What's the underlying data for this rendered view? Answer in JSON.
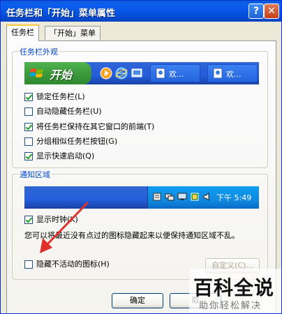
{
  "window": {
    "title": "任务栏和「开始」菜单属性",
    "help_glyph": "?",
    "close_glyph": "✕"
  },
  "tabs": [
    {
      "label": "任务栏",
      "active": true
    },
    {
      "label": "「开始」菜单",
      "active": false
    }
  ],
  "taskbar_appearance": {
    "group_title": "任务栏外观",
    "start_label": "开始",
    "task_buttons": [
      {
        "label": "欢..."
      },
      {
        "label": "欢..."
      }
    ],
    "options": [
      {
        "label": "锁定任务栏(L)",
        "checked": true
      },
      {
        "label": "自动隐藏任务栏(U)",
        "checked": false
      },
      {
        "label": "将任务栏保持在其它窗口的前端(T)",
        "checked": true
      },
      {
        "label": "分组相似任务栏按钮(G)",
        "checked": false
      },
      {
        "label": "显示快速启动(Q)",
        "checked": true
      }
    ]
  },
  "notification_area": {
    "group_title": "通知区域",
    "clock_text": "下午 5:49",
    "show_clock_label": "显示时钟(K)",
    "show_clock_checked": true,
    "description": "您可以将最近没有点过的图标隐藏起来以便保持通知区域不乱。",
    "hide_inactive_label": "隐藏不活动的图标(H)",
    "hide_inactive_checked": false,
    "customize_label": "自定义(C)..."
  },
  "buttons": {
    "ok": "确定",
    "cancel": "取"
  },
  "watermark": {
    "title": "百科全说",
    "subtitle": "助你轻松解决"
  },
  "colors": {
    "titlebar": "#0553e0",
    "group_title": "#0046d5",
    "start_green": "#3c9a3c",
    "annotation_arrow": "#e0302a"
  },
  "icons": {
    "help": "help-icon",
    "close": "close-icon",
    "windows_logo": "windows-logo-icon"
  }
}
